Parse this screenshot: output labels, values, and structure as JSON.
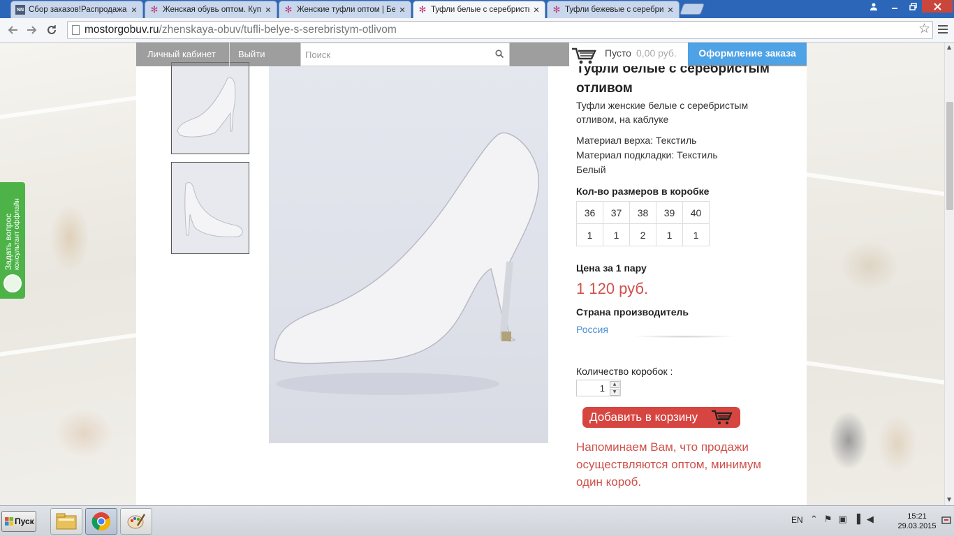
{
  "browser": {
    "tabs": [
      {
        "title": "Сбор заказов!Распродажа д",
        "favicon": "nn-icon",
        "active": false
      },
      {
        "title": "Женская обувь оптом. Куп",
        "favicon": "flower-icon",
        "active": false
      },
      {
        "title": "Женские туфли оптом | Бе",
        "favicon": "flower-icon",
        "active": false
      },
      {
        "title": "Туфли белые с серебристь",
        "favicon": "flower-icon",
        "active": true
      },
      {
        "title": "Туфли бежевые с серебрис",
        "favicon": "flower-icon",
        "active": false
      }
    ],
    "url_host": "mostorgobuv.ru",
    "url_path": "/zhenskaya-obuv/tufli-belye-s-serebristym-otlivom"
  },
  "site_header": {
    "account_label": "Личный кабинет",
    "logout_label": "Выйти",
    "search_placeholder": "Поиск",
    "cart_status": "Пусто",
    "cart_sum": "0,00 руб.",
    "checkout_label": "Оформление заказа"
  },
  "product": {
    "title": "Туфли белые с серебристым отливом",
    "description": "Туфли женские белые с серебристым отливом, на каблуке",
    "attributes": [
      "Материал верха: Текстиль",
      "Материал подкладки: Текстиль",
      "Белый"
    ],
    "sizes_heading": "Кол-во размеров в коробке",
    "sizes": [
      "36",
      "37",
      "38",
      "39",
      "40"
    ],
    "size_counts": [
      "1",
      "1",
      "2",
      "1",
      "1"
    ],
    "price_heading": "Цена за 1 пару",
    "price": "1 120 руб.",
    "country_heading": "Страна производитель",
    "country": "Россия",
    "quantity_label": "Количество коробок :",
    "quantity_value": "1",
    "add_to_cart_label": "Добавить в корзину",
    "notice": "Напоминаем Вам, что продажи осуществляются оптом, минимум один короб."
  },
  "consultant_widget": {
    "line1": "Задать вопрос",
    "line2": "консультант оффлайн"
  },
  "taskbar": {
    "start_label": "Пуск",
    "language": "EN",
    "time": "15:21",
    "date": "29.03.2015"
  },
  "colors": {
    "accent_blue": "#4ea2e6",
    "price_red": "#d0504a",
    "button_red": "#d74540",
    "widget_green": "#4db348"
  }
}
